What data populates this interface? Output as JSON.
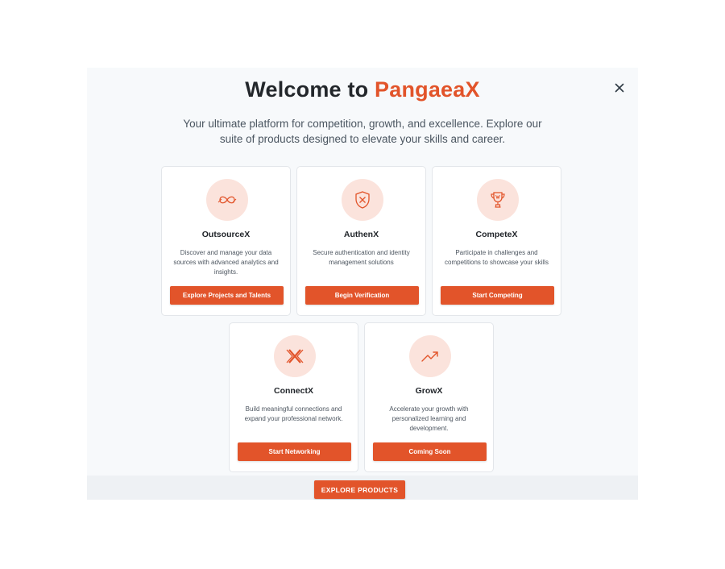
{
  "header": {
    "title_prefix": "Welcome to ",
    "title_brand": "PangaeaX",
    "subtitle": "Your ultimate platform for competition, growth, and excellence. Explore our suite of products designed to elevate your skills and career."
  },
  "products": [
    {
      "icon": "infinity-icon",
      "title": "OutsourceX",
      "description": "Discover and manage your data sources with advanced analytics and insights.",
      "button_label": "Explore Projects and Talents"
    },
    {
      "icon": "shield-icon",
      "title": "AuthenX",
      "description": "Secure authentication and identity management solutions",
      "button_label": "Begin Verification"
    },
    {
      "icon": "trophy-icon",
      "title": "CompeteX",
      "description": "Participate in challenges and competitions to showcase your skills",
      "button_label": "Start Competing"
    },
    {
      "icon": "x-logo-icon",
      "title": "ConnectX",
      "description": "Build meaningful connections and expand your professional network.",
      "button_label": "Start Networking"
    },
    {
      "icon": "trending-up-icon",
      "title": "GrowX",
      "description": "Accelerate your growth with personalized learning and development.",
      "button_label": "Coming Soon"
    }
  ],
  "footer": {
    "explore_label": "EXPLORE PRODUCTS"
  },
  "colors": {
    "accent": "#e2542a",
    "icon_bg": "#fbe3dc",
    "modal_bg": "#f7f9fb"
  }
}
